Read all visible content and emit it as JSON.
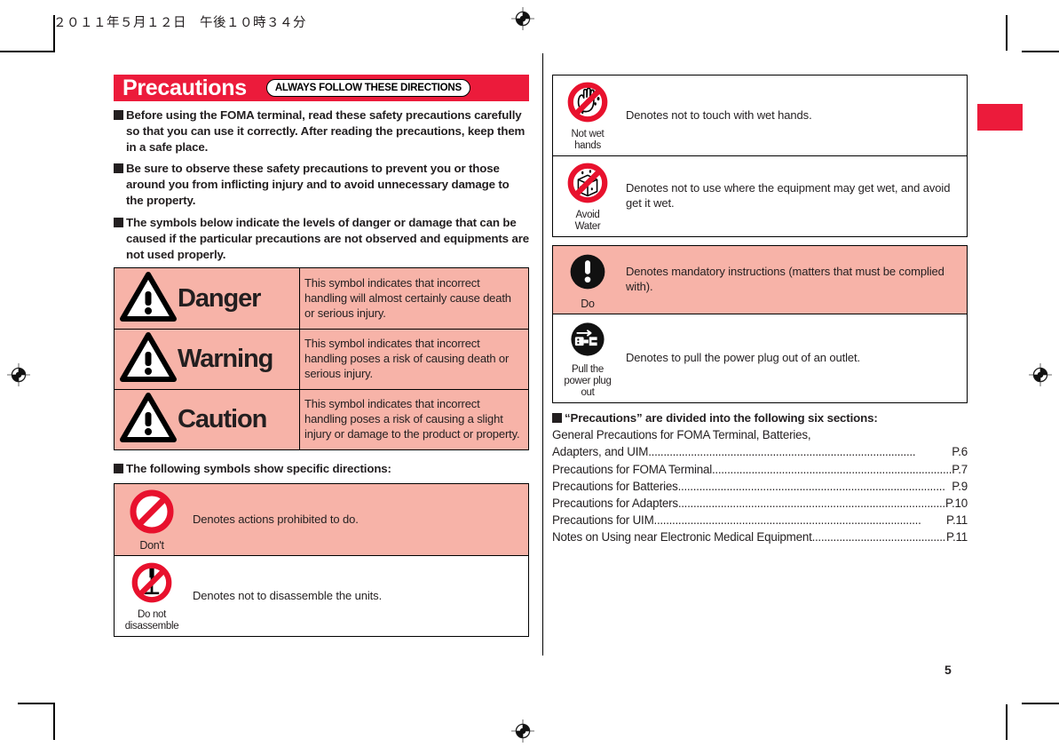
{
  "document": {
    "date_header": "２０１１年５月１２日　午後１０時３４分",
    "page_number": "5"
  },
  "banner": {
    "title": "Precautions",
    "pill": "ALWAYS FOLLOW THESE DIRECTIONS",
    "bg_color": "#ec1b3b"
  },
  "intro": {
    "paragraphs": [
      "Before using the FOMA terminal, read these safety precautions carefully so that you can use it correctly. After reading the precautions, keep them in a safe place.",
      "Be sure to observe these safety precautions to prevent you or those around you from inflicting injury and to avoid unnecessary damage to the property.",
      "The symbols below indicate the levels of danger or damage that can be caused if the particular precautions are not observed and equipments are not used properly."
    ]
  },
  "level_table": {
    "highlight_color": "#f7b3a8",
    "rows": [
      {
        "icon": "warning-triangle-icon",
        "word": "Danger",
        "description": "This symbol indicates that incorrect handling will almost certainly cause death or serious injury."
      },
      {
        "icon": "warning-triangle-icon",
        "word": "Warning",
        "description": "This symbol indicates that incorrect handling poses a risk of causing death or serious injury."
      },
      {
        "icon": "warning-triangle-icon",
        "word": "Caution",
        "description": "This symbol indicates that incorrect handling poses a risk of causing a slight injury or damage to the product or property."
      }
    ]
  },
  "directions_heading": "The following symbols show specific directions:",
  "directions_left": {
    "rows": [
      {
        "icon": "prohibited-circle-icon",
        "caption": "Don't",
        "caption_lines": [
          "Don't"
        ],
        "description": "Denotes actions prohibited to do.",
        "shaded": true
      },
      {
        "icon": "no-disassemble-icon",
        "caption": "Do not disassemble",
        "caption_lines": [
          "Do not",
          "disassemble"
        ],
        "description": "Denotes not to disassemble the units.",
        "shaded": false
      }
    ]
  },
  "directions_right_prohibit": {
    "rows": [
      {
        "icon": "no-wet-hands-icon",
        "caption": "Not wet hands",
        "caption_lines": [
          "Not wet",
          "hands"
        ],
        "description": "Denotes not to touch with wet hands.",
        "shaded": false
      },
      {
        "icon": "avoid-water-icon",
        "caption": "Avoid Water",
        "caption_lines": [
          "Avoid",
          "Water"
        ],
        "description": "Denotes not to use where the equipment may get wet, and avoid get it wet.",
        "shaded": false
      }
    ]
  },
  "directions_right_mandatory": {
    "rows": [
      {
        "icon": "mandatory-exclamation-icon",
        "caption": "Do",
        "caption_lines": [
          "Do"
        ],
        "description": "Denotes mandatory instructions (matters that must be complied with).",
        "shaded": true
      },
      {
        "icon": "unplug-power-icon",
        "caption": "Pull the power plug out",
        "caption_lines": [
          "Pull the",
          "power plug",
          "out"
        ],
        "description": "Denotes to pull the power plug out of an outlet.",
        "shaded": false
      }
    ]
  },
  "toc": {
    "title": "“Precautions” are divided into the following six sections:",
    "entries": [
      {
        "label": "General Precautions for FOMA Terminal, Batteries,",
        "page": "",
        "continued": true
      },
      {
        "label": "Adapters, and UIM",
        "page": "P.6",
        "continued": false
      },
      {
        "label": "Precautions for FOMA Terminal",
        "page": "P.7",
        "continued": false
      },
      {
        "label": "Precautions for Batteries",
        "page": "P.9",
        "continued": false
      },
      {
        "label": "Precautions for Adapters ",
        "page": "P.10",
        "continued": false
      },
      {
        "label": "Precautions for UIM ",
        "page": "P.11",
        "continued": false
      },
      {
        "label": "Notes on Using near Electronic Medical Equipment",
        "page": "P.11",
        "continued": false
      }
    ]
  },
  "thumb_tab": {
    "color": "#ec1b3b"
  }
}
